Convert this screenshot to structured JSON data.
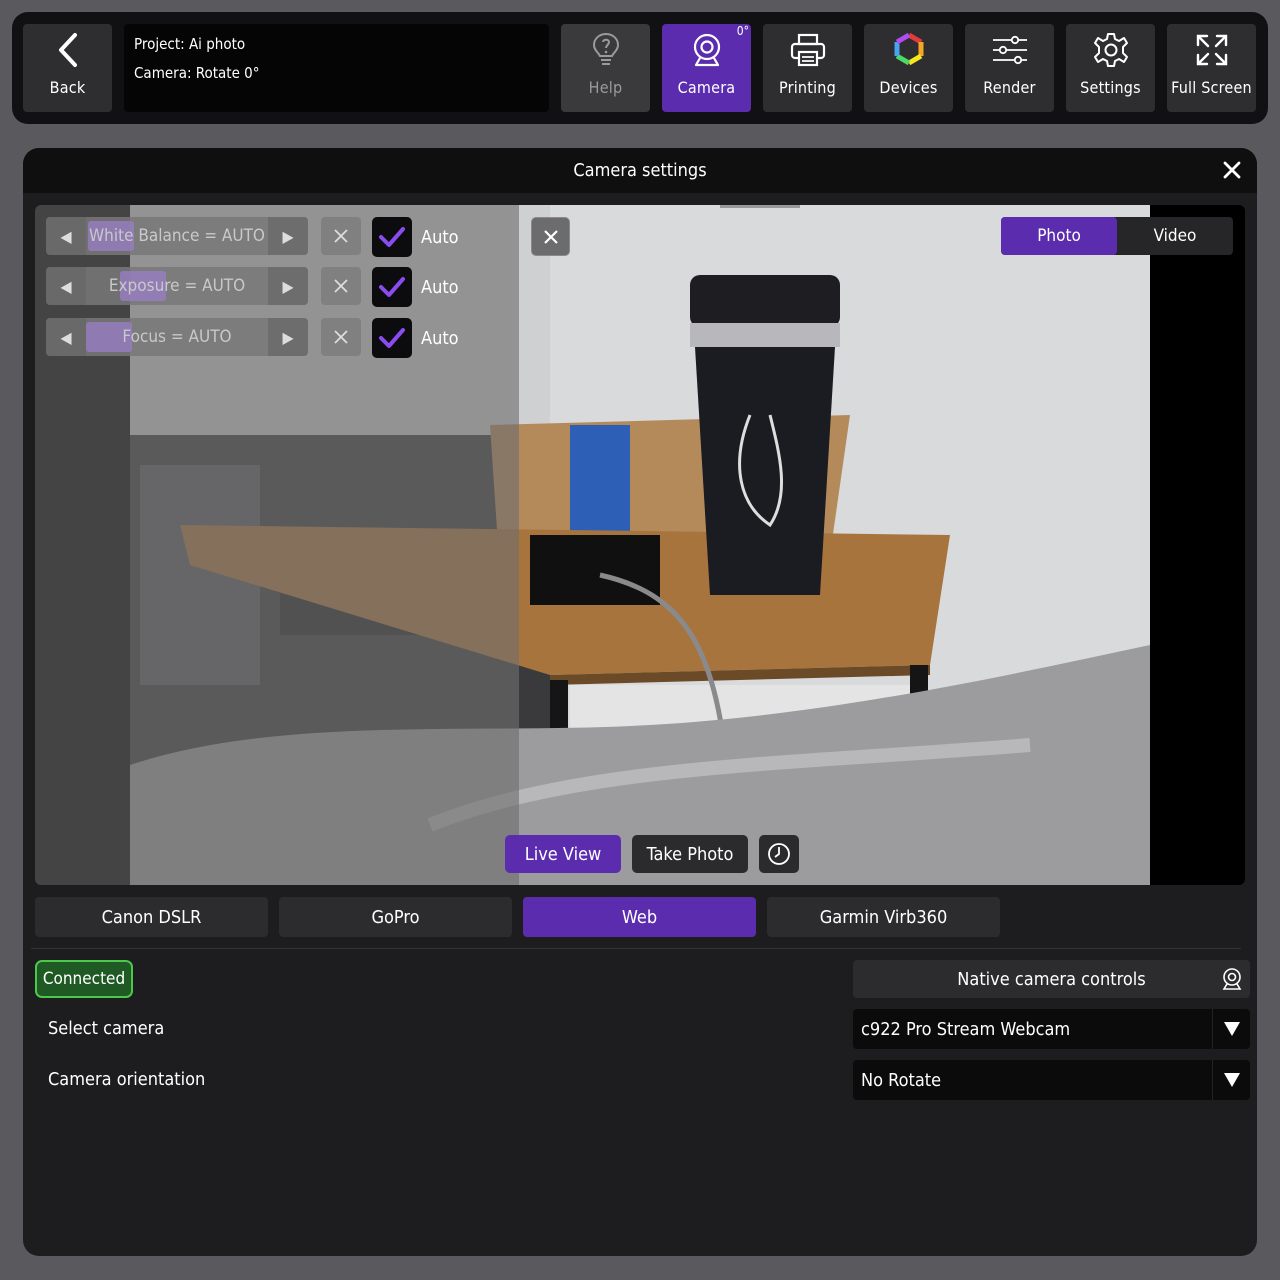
{
  "topbar": {
    "back_label": "Back",
    "project_line": "Project: Ai photo",
    "camera_line": "Camera: Rotate 0°",
    "rotation_badge": "0°",
    "buttons": [
      {
        "label": "Help",
        "icon": "lightbulb-question-icon",
        "state": "disabled"
      },
      {
        "label": "Camera",
        "icon": "webcam-icon",
        "state": "active"
      },
      {
        "label": "Printing",
        "icon": "printer-icon",
        "state": "normal"
      },
      {
        "label": "Devices",
        "icon": "color-ring-icon",
        "state": "normal"
      },
      {
        "label": "Render",
        "icon": "sliders-icon",
        "state": "normal"
      },
      {
        "label": "Settings",
        "icon": "gear-icon",
        "state": "normal"
      },
      {
        "label": "Full Screen",
        "icon": "expand-icon",
        "state": "normal"
      }
    ]
  },
  "panel": {
    "title": "Camera settings"
  },
  "controls": [
    {
      "label": "White Balance = AUTO",
      "auto_label": "Auto",
      "auto_checked": true
    },
    {
      "label": "Exposure = AUTO",
      "auto_label": "Auto",
      "auto_checked": true
    },
    {
      "label": "Focus = AUTO",
      "auto_label": "Auto",
      "auto_checked": true
    }
  ],
  "mode_toggle": {
    "photo": "Photo",
    "video": "Video",
    "selected": "Photo"
  },
  "live_view_label": "Live View",
  "take_photo_label": "Take Photo",
  "sources": {
    "tabs": [
      "Canon DSLR",
      "GoPro",
      "Web",
      "Garmin Virb360"
    ],
    "selected": "Web"
  },
  "status": {
    "connected_label": "Connected"
  },
  "native_controls_label": "Native camera controls",
  "select_camera": {
    "label": "Select camera",
    "value": "c922 Pro Stream Webcam"
  },
  "camera_orientation": {
    "label": "Camera orientation",
    "value": "No Rotate"
  },
  "colors": {
    "accent": "#5b2dae",
    "connected": "#4cc84c",
    "check": "#8a4cf0"
  }
}
